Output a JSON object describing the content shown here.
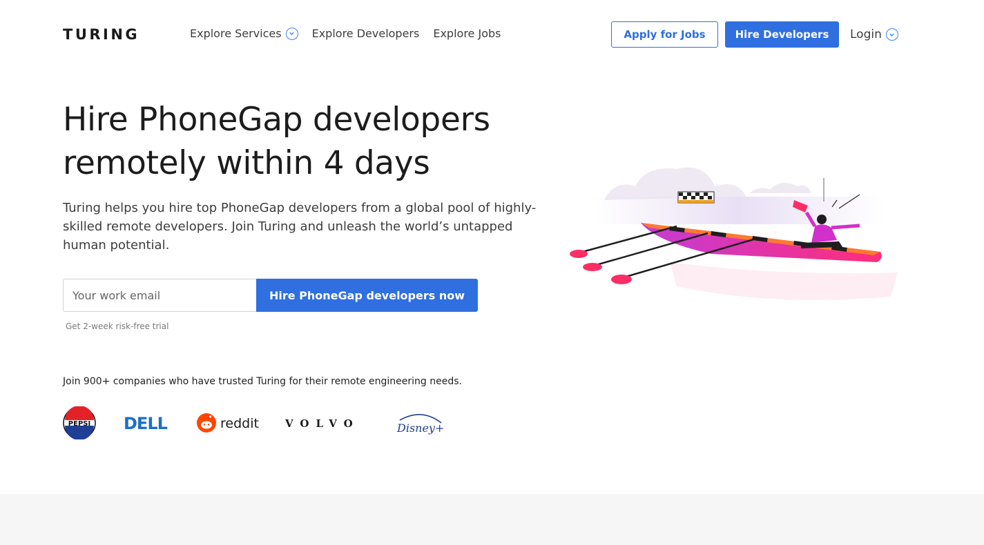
{
  "header": {
    "logo": "TURING",
    "nav": [
      {
        "label": "Explore Services",
        "has_dropdown": true
      },
      {
        "label": "Explore Developers",
        "has_dropdown": false
      },
      {
        "label": "Explore Jobs",
        "has_dropdown": false
      }
    ],
    "apply_label": "Apply for Jobs",
    "hire_label": "Hire Developers",
    "login_label": "Login"
  },
  "hero": {
    "title_line1": "Hire PhoneGap developers",
    "title_line2": "remotely within 4 days",
    "description": "Turing helps you hire top PhoneGap developers from a global pool of highly-skilled remote developers. Join Turing and unleash the world’s untapped human potential.",
    "email_placeholder": "Your work email",
    "cta_label": "Hire PhoneGap developers now",
    "trial_note": "Get 2-week risk-free trial"
  },
  "trust": {
    "text": "Join 900+ companies who have trusted Turing for their remote engineering needs.",
    "logos": [
      "PEPSI",
      "DELL",
      "reddit",
      "VOLVO",
      "Disney+"
    ]
  },
  "colors": {
    "accent": "#2f6fe0",
    "text": "#1c1c1c",
    "footer_band": "#f6f6f6"
  }
}
